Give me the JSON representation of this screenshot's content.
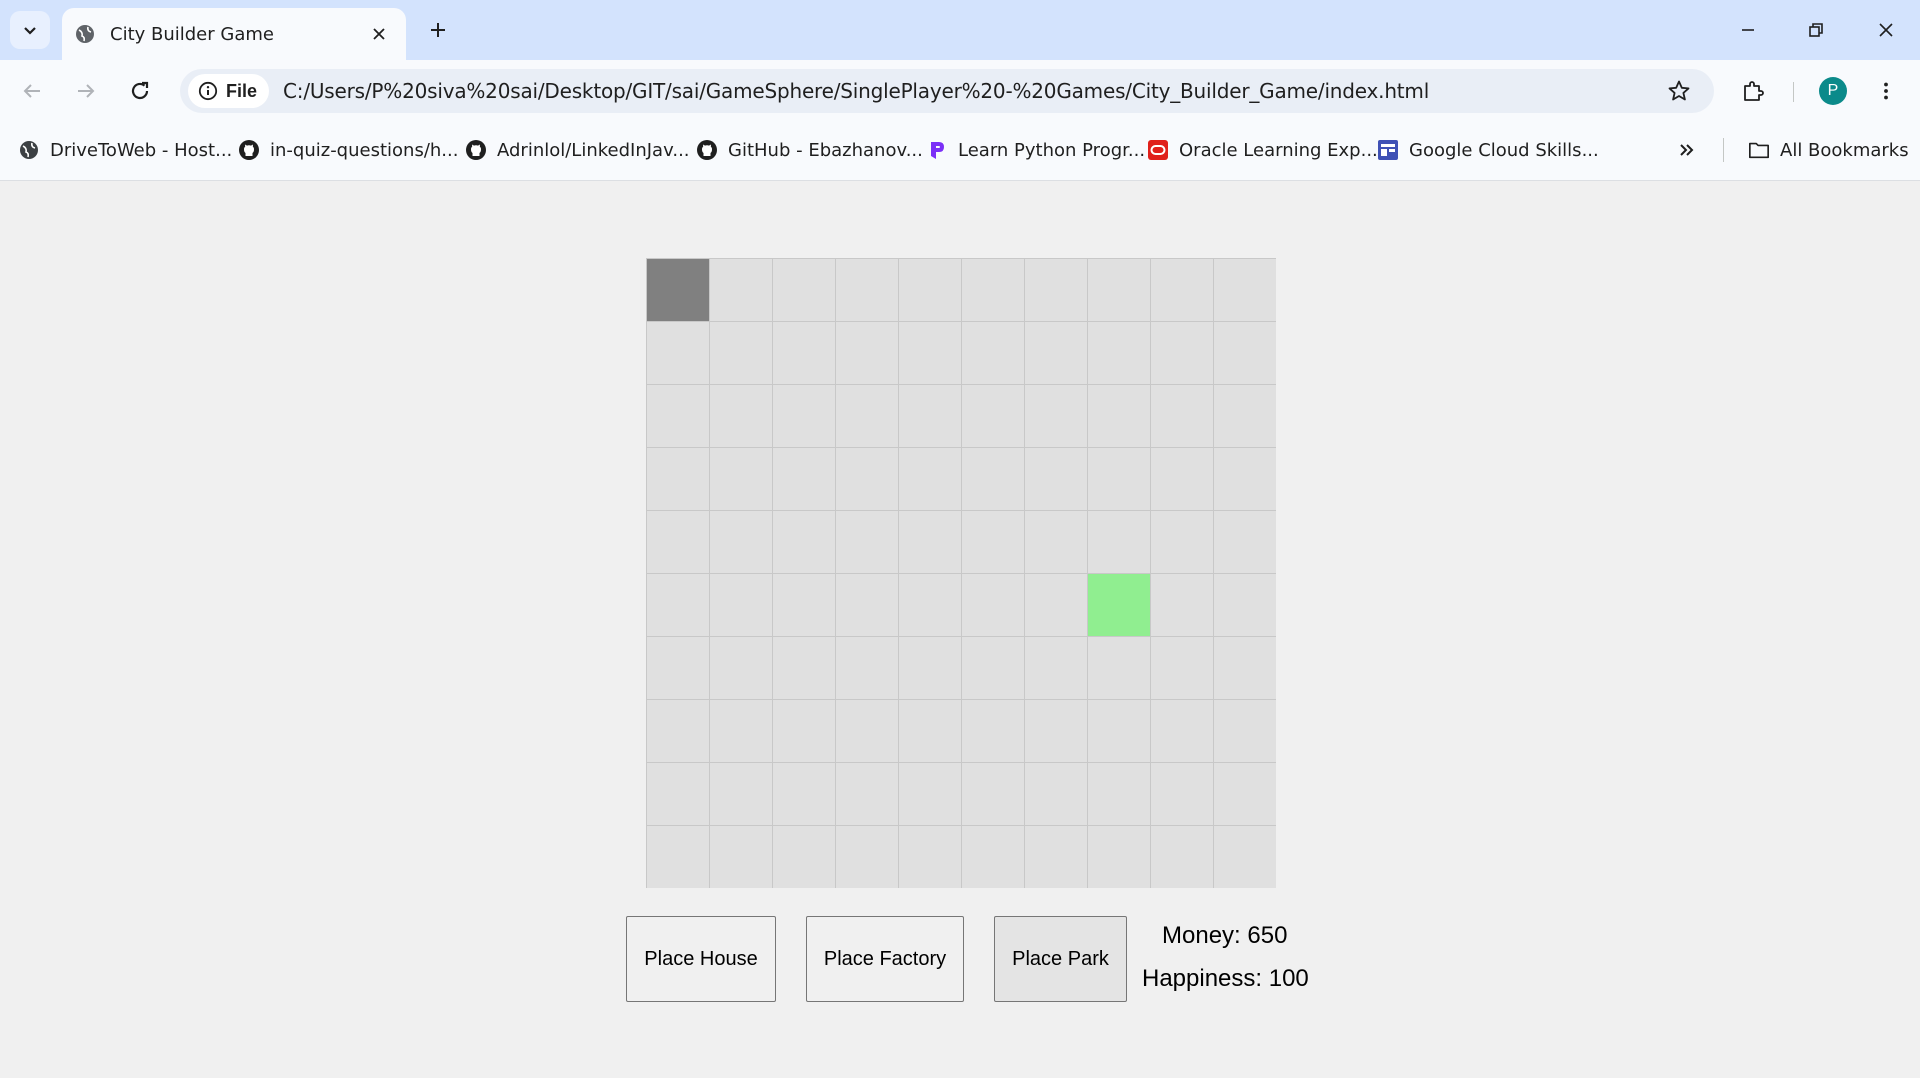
{
  "browser": {
    "tab_title": "City Builder Game",
    "address_chip": "File",
    "url": "C:/Users/P%20siva%20sai/Desktop/GIT/sai/GameSphere/SinglePlayer%20-%20Games/City_Builder_Game/index.html",
    "profile_initial": "P",
    "bookmarks": [
      {
        "label": "DriveToWeb - Host...",
        "icon": "globe-icon"
      },
      {
        "label": "in-quiz-questions/h...",
        "icon": "github-icon"
      },
      {
        "label": "Adrinlol/LinkedInJav...",
        "icon": "github-icon"
      },
      {
        "label": "GitHub - Ebazhanov...",
        "icon": "github-icon"
      },
      {
        "label": "Learn Python Progr...",
        "icon": "programiz-icon"
      },
      {
        "label": "Oracle Learning Exp...",
        "icon": "oracle-icon"
      },
      {
        "label": "Google Cloud Skills...",
        "icon": "cloud-skills-icon"
      }
    ],
    "all_bookmarks": "All Bookmarks"
  },
  "game": {
    "grid_rows": 10,
    "grid_cols": 10,
    "buildings": [
      {
        "row": 0,
        "col": 0,
        "type": "house"
      },
      {
        "row": 5,
        "col": 7,
        "type": "park"
      }
    ],
    "colors": {
      "empty": "#e0e0e0",
      "house": "#808080",
      "park": "#90ee90"
    },
    "buttons": {
      "house": "Place House",
      "factory": "Place Factory",
      "park": "Place Park"
    },
    "stats": {
      "money": "Money: 650",
      "happiness": "Happiness: 100"
    }
  }
}
